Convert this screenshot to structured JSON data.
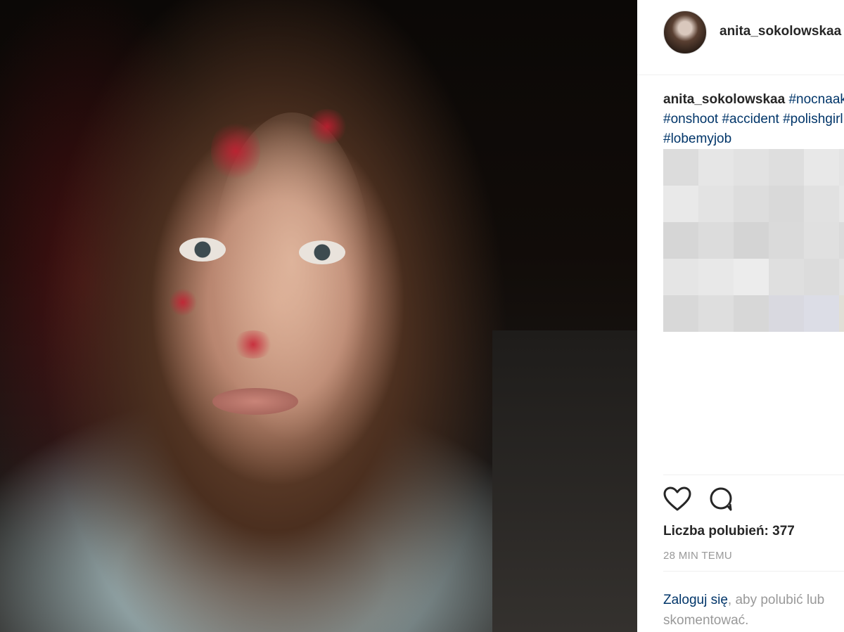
{
  "post": {
    "username": "anita_sokolowskaa",
    "caption": {
      "user": "anita_sokolowskaa",
      "tags": [
        "#nocnaakcja",
        "#onshoot",
        "#accident",
        "#polishgirl",
        "#lobemyjob"
      ]
    },
    "likes_label": "Liczba polubień: 377",
    "time": "28 MIN TEMU",
    "login": {
      "link": "Zaloguj się",
      "text": ", aby polubić lub skomentować."
    }
  },
  "icons": {
    "like": "heart-icon",
    "comment": "comment-bubble-icon"
  },
  "colors": {
    "link": "#003569",
    "text": "#262626",
    "muted": "#999999",
    "border": "#efefef"
  },
  "pixel_blocks": [
    "#dcdcdc",
    "#e6e6e6",
    "#e2e2e2",
    "#dedede",
    "#e8e8e8",
    "#e4e4e4",
    "#e9e9e9",
    "#e3e3e3",
    "#dddddd",
    "#d9d9d9",
    "#e1e1e1",
    "#e7e7e7",
    "#d6d6d6",
    "#dcdcdc",
    "#d4d4d4",
    "#dadada",
    "#e0e0e0",
    "#dbdbdb",
    "#e5e5e5",
    "#e8e8e8",
    "#ececec",
    "#dfdfdf",
    "#dcdcdc",
    "#e2e2e2",
    "#d8d8d8",
    "#dedede",
    "#d7d7d7",
    "#d9d9e0",
    "#dcdde6",
    "#e1dfd6"
  ]
}
